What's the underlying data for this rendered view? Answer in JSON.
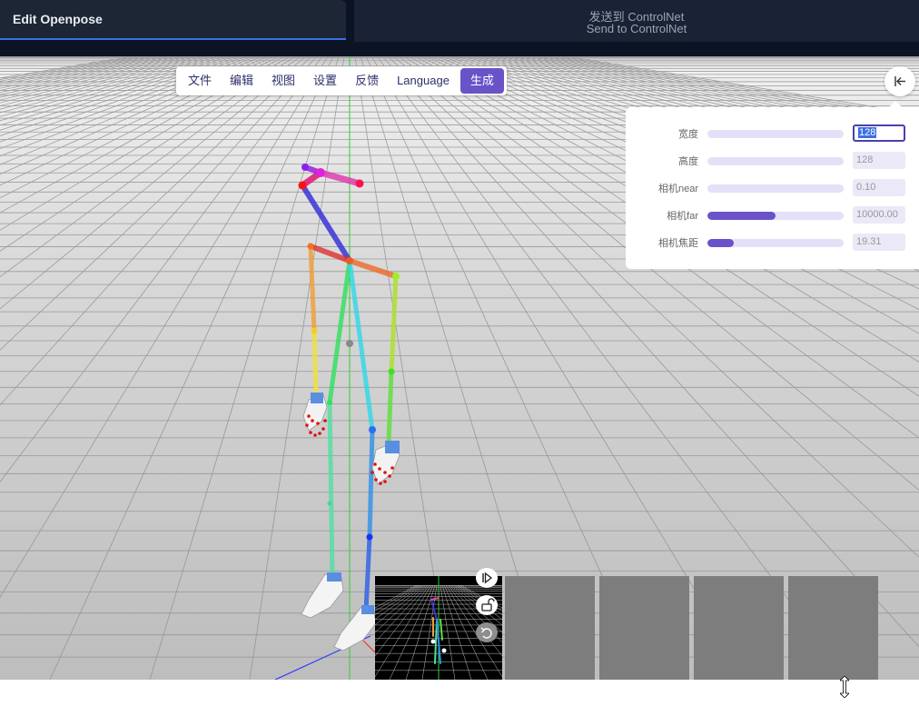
{
  "header": {
    "title": "Edit Openpose",
    "send_line1": "发送到 ControlNet",
    "send_line2": "Send to ControlNet"
  },
  "menu": {
    "items": [
      "文件",
      "编辑",
      "视图",
      "设置",
      "反馈",
      "Language"
    ],
    "primary": "生成"
  },
  "icons": {
    "collapse": "collapse-left-icon",
    "play": "play-step-icon",
    "lock": "unlock-icon",
    "undo": "undo-icon",
    "cursor": "resize-vertical-cursor-icon"
  },
  "settings": {
    "rows": [
      {
        "label": "宽度",
        "value": "128",
        "fill": 0.0
      },
      {
        "label": "高度",
        "value": "128",
        "fill": 0.0
      },
      {
        "label": "相机near",
        "value": "0.10",
        "fill": 0.0
      },
      {
        "label": "相机far",
        "value": "10000.00",
        "fill": 0.5
      },
      {
        "label": "相机焦距",
        "value": "19.31",
        "fill": 0.19
      }
    ]
  },
  "colors": {
    "accent": "#6a53c9",
    "header_bg": "#0b1324",
    "floor": "#b9b9b9"
  }
}
